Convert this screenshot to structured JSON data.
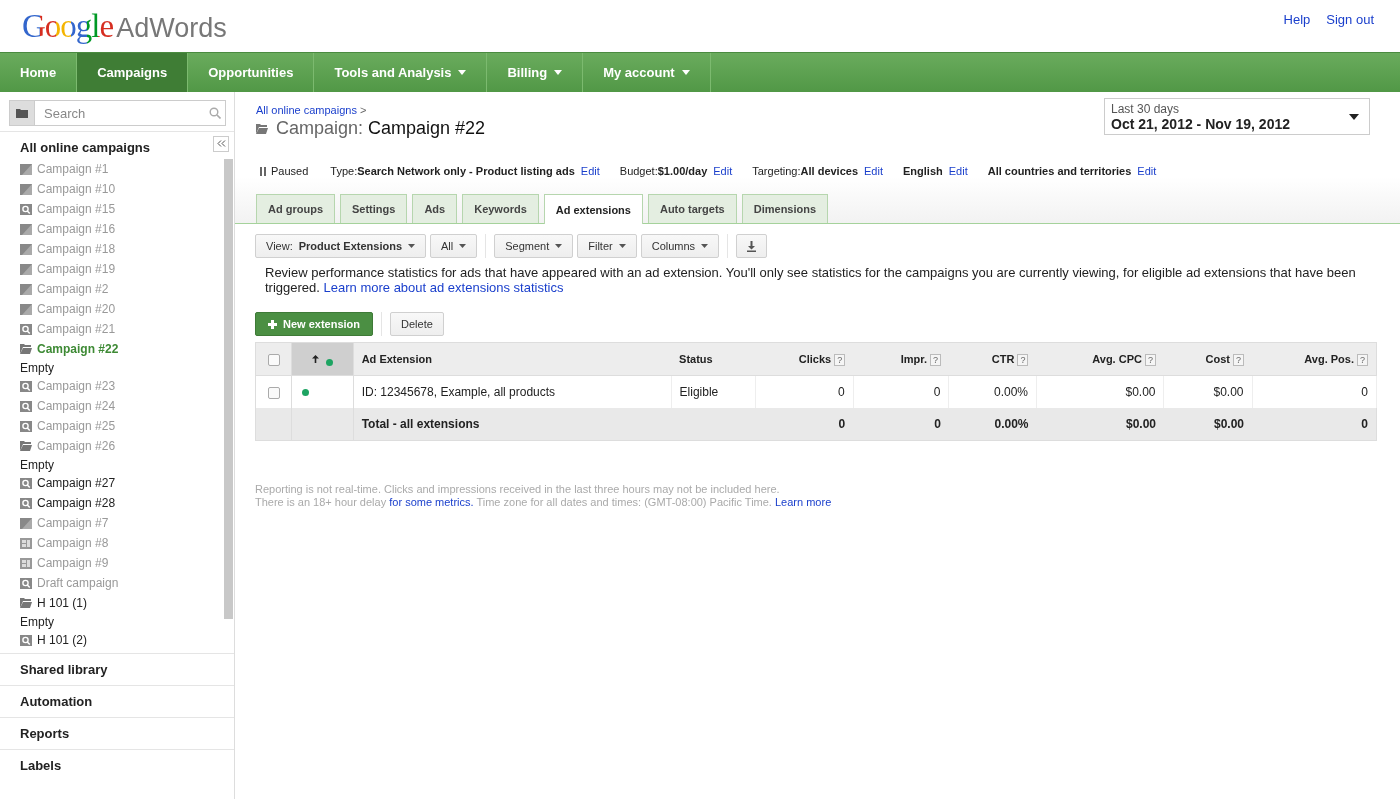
{
  "header": {
    "logo": {
      "brand": "Google",
      "product": "AdWords"
    },
    "links": [
      "Help",
      "Sign out"
    ]
  },
  "nav": [
    {
      "label": "Home",
      "selected": false,
      "dropdown": false
    },
    {
      "label": "Campaigns",
      "selected": true,
      "dropdown": false
    },
    {
      "label": "Opportunities",
      "selected": false,
      "dropdown": false
    },
    {
      "label": "Tools and Analysis",
      "selected": false,
      "dropdown": true
    },
    {
      "label": "Billing",
      "selected": false,
      "dropdown": true
    },
    {
      "label": "My account",
      "selected": false,
      "dropdown": true
    }
  ],
  "sidebar": {
    "search": {
      "placeholder": "Search"
    },
    "title": "All online campaigns",
    "tree": [
      {
        "label": "Campaign #1",
        "kind": "paused",
        "greyed": true,
        "selected": false
      },
      {
        "label": "Campaign #10",
        "kind": "paused",
        "greyed": true,
        "selected": false
      },
      {
        "label": "Campaign #15",
        "kind": "search",
        "greyed": true,
        "selected": false
      },
      {
        "label": "Campaign #16",
        "kind": "paused",
        "greyed": true,
        "selected": false
      },
      {
        "label": "Campaign #18",
        "kind": "paused",
        "greyed": true,
        "selected": false
      },
      {
        "label": "Campaign #19",
        "kind": "paused",
        "greyed": true,
        "selected": false
      },
      {
        "label": "Campaign #2",
        "kind": "paused",
        "greyed": true,
        "selected": false
      },
      {
        "label": "Campaign #20",
        "kind": "paused",
        "greyed": true,
        "selected": false
      },
      {
        "label": "Campaign #21",
        "kind": "search",
        "greyed": true,
        "selected": false
      },
      {
        "label": "Campaign #22",
        "kind": "folder",
        "greyed": false,
        "selected": true,
        "children": [
          {
            "label": "Empty",
            "kind": "empty",
            "greyed": false,
            "selected": false
          }
        ]
      },
      {
        "label": "Campaign #23",
        "kind": "search",
        "greyed": true,
        "selected": false
      },
      {
        "label": "Campaign #24",
        "kind": "search",
        "greyed": true,
        "selected": false
      },
      {
        "label": "Campaign #25",
        "kind": "search",
        "greyed": true,
        "selected": false
      },
      {
        "label": "Campaign #26",
        "kind": "folder",
        "greyed": true,
        "selected": false,
        "children": [
          {
            "label": "Empty",
            "kind": "empty",
            "greyed": false,
            "selected": false
          }
        ]
      },
      {
        "label": "Campaign #27",
        "kind": "search",
        "greyed": false,
        "selected": false
      },
      {
        "label": "Campaign #28",
        "kind": "search",
        "greyed": false,
        "selected": false
      },
      {
        "label": "Campaign #7",
        "kind": "paused",
        "greyed": true,
        "selected": false
      },
      {
        "label": "Campaign #8",
        "kind": "grid",
        "greyed": true,
        "selected": false
      },
      {
        "label": "Campaign #9",
        "kind": "grid",
        "greyed": true,
        "selected": false
      },
      {
        "label": "Draft campaign",
        "kind": "search",
        "greyed": true,
        "selected": false
      },
      {
        "label": "H 101 (1)",
        "kind": "folder",
        "greyed": false,
        "selected": false,
        "children": [
          {
            "label": "Empty",
            "kind": "empty",
            "greyed": false,
            "selected": false
          }
        ]
      },
      {
        "label": "H 101 (2)",
        "kind": "search",
        "greyed": false,
        "selected": false
      }
    ],
    "sections": [
      "Shared library",
      "Automation",
      "Reports",
      "Labels"
    ]
  },
  "main": {
    "breadcrumb": {
      "link": "All online campaigns",
      "separator": ">"
    },
    "title": {
      "prefix": "Campaign:",
      "name": "Campaign #22"
    },
    "date_range": {
      "label": "Last 30 days",
      "value": "Oct 21, 2012 - Nov 19, 2012"
    },
    "summary": {
      "status": "Paused",
      "items": [
        {
          "label": "Type:",
          "value": "Search Network only - Product listing ads",
          "edit": "Edit"
        },
        {
          "label": "Budget:",
          "value": "$1.00/day",
          "edit": "Edit"
        },
        {
          "label": "Targeting:",
          "value": "All devices",
          "edit": "Edit"
        },
        {
          "value": "English",
          "edit": "Edit"
        },
        {
          "value": "All countries and territories",
          "edit": "Edit"
        }
      ]
    },
    "tabs": [
      {
        "label": "Ad groups",
        "selected": false
      },
      {
        "label": "Settings",
        "selected": false
      },
      {
        "label": "Ads",
        "selected": false
      },
      {
        "label": "Keywords",
        "selected": false
      },
      {
        "label": "Ad extensions",
        "selected": true
      },
      {
        "label": "Auto targets",
        "selected": false
      },
      {
        "label": "Dimensions",
        "selected": false
      }
    ],
    "toolbar": {
      "view": {
        "label": "View:",
        "value": "Product Extensions"
      },
      "menus": [
        "All",
        "Segment",
        "Filter",
        "Columns"
      ]
    },
    "description": {
      "text": "Review performance statistics for ads that have appeared with an ad extension. You'll only see statistics for the campaigns you are currently viewing, for eligible ad extensions that have been triggered.",
      "link": "Learn more about ad extensions statistics"
    },
    "actions": {
      "primary": "New extension",
      "secondary": "Delete"
    },
    "table": {
      "header_checked": false,
      "columns": [
        {
          "label": "Ad Extension"
        },
        {
          "label": "Status"
        },
        {
          "label": "Clicks",
          "help": "?"
        },
        {
          "label": "Impr.",
          "help": "?"
        },
        {
          "label": "CTR",
          "help": "?"
        },
        {
          "label": "Avg. CPC",
          "help": "?"
        },
        {
          "label": "Cost",
          "help": "?"
        },
        {
          "label": "Avg. Pos.",
          "help": "?"
        }
      ],
      "rows": [
        {
          "checked": false,
          "cells": [
            "ID: 12345678, Example, all products",
            "Eligible",
            "0",
            "0",
            "0.00%",
            "$0.00",
            "$0.00",
            "0"
          ]
        }
      ],
      "total": {
        "label": "Total - all extensions",
        "cells": [
          "0",
          "0",
          "0.00%",
          "$0.00",
          "$0.00",
          "0"
        ]
      }
    },
    "notes": {
      "line1": "Reporting is not real-time. Clicks and impressions received in the last three hours may not be included here.",
      "line2_start": "There is an 18+ hour delay",
      "line2_link": "for some metrics.",
      "line2_end": "Time zone for all dates and times: (GMT-08:00) Pacific Time.",
      "learn_more": "Learn more"
    }
  }
}
